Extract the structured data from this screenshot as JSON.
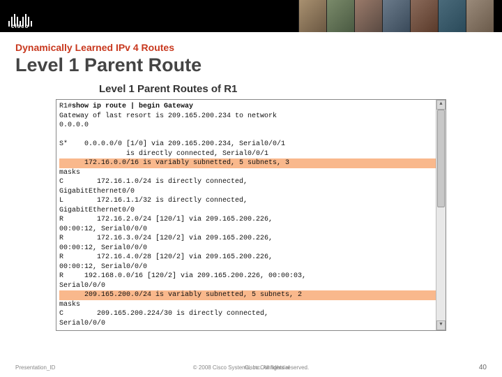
{
  "header": {
    "logo_text": "cisco"
  },
  "slide": {
    "subtitle": "Dynamically Learned IPv 4 Routes",
    "title": "Level 1 Parent Route",
    "box_title": "Level 1 Parent Routes of R1"
  },
  "cli": {
    "prompt": "R1#",
    "command": "show ip route | begin Gateway",
    "lines": [
      "Gateway of last resort is 209.165.200.234 to network",
      "0.0.0.0",
      "",
      "S*    0.0.0.0/0 [1/0] via 209.165.200.234, Serial0/0/1",
      "                is directly connected, Serial0/0/1",
      "      172.16.0.0/16 is variably subnetted, 5 subnets, 3",
      "masks",
      "C        172.16.1.0/24 is directly connected,",
      "GigabitEthernet0/0",
      "L        172.16.1.1/32 is directly connected,",
      "GigabitEthernet0/0",
      "R        172.16.2.0/24 [120/1] via 209.165.200.226,",
      "00:00:12, Serial0/0/0",
      "R        172.16.3.0/24 [120/2] via 209.165.200.226,",
      "00:00:12, Serial0/0/0",
      "R        172.16.4.0/28 [120/2] via 209.165.200.226,",
      "00:00:12, Serial0/0/0",
      "R     192.168.0.0/16 [120/2] via 209.165.200.226, 00:00:03,",
      "Serial0/0/0",
      "      209.165.200.0/24 is variably subnetted, 5 subnets, 2",
      "masks",
      "C        209.165.200.224/30 is directly connected,",
      "Serial0/0/0"
    ],
    "highlight_indexes": [
      5,
      19
    ]
  },
  "footer": {
    "left": "Presentation_ID",
    "center": "© 2008 Cisco Systems, Inc. All rights reserved.",
    "right": "Cisco Confidential",
    "page": "40"
  }
}
